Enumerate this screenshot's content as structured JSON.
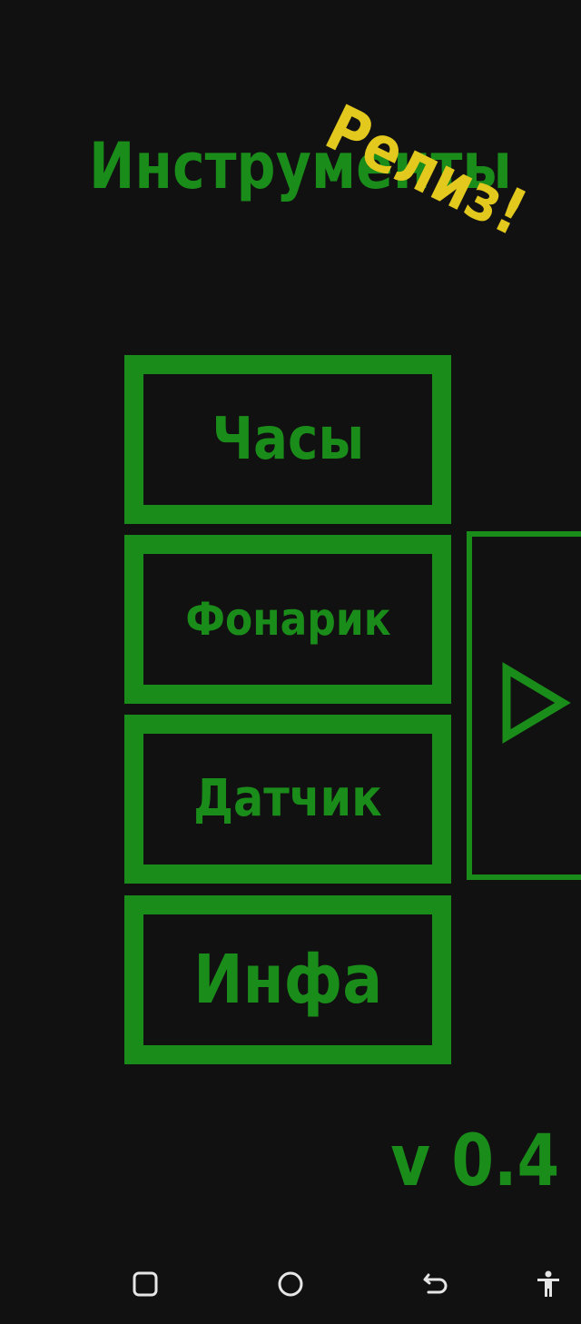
{
  "app": {
    "title": "Инструменты",
    "badge": "Релиз!"
  },
  "menu": {
    "clock_label": "Часы",
    "flashlight_label": "Фонарик",
    "sensor_label": "Датчик",
    "info_label": "Инфа"
  },
  "side": {
    "next_icon": "play-triangle-icon"
  },
  "footer": {
    "version": "v 0.4"
  },
  "navbar": {
    "icons": [
      "recent-apps-icon",
      "home-icon",
      "back-icon",
      "accessibility-icon"
    ]
  },
  "colors": {
    "background": "#111111",
    "accent": "#1a8c1a",
    "badge": "#e3c81e",
    "nav_icon": "#e6e6e6"
  }
}
